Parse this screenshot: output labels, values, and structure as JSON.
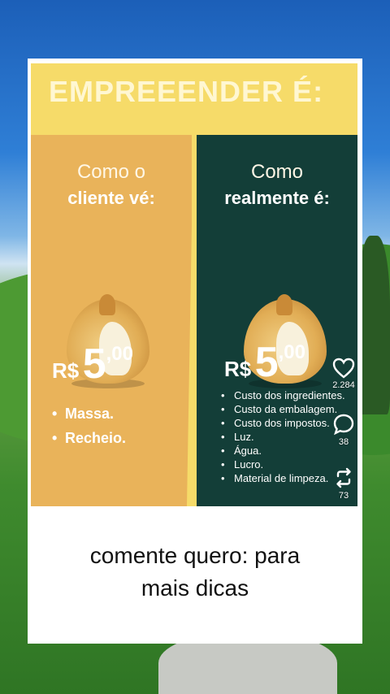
{
  "poster": {
    "title": "EMPREEENDER   É:",
    "left": {
      "line1": "Como o",
      "line2": "cliente vé:",
      "price_currency": "R$",
      "price_main": "5",
      "price_cents": ",00",
      "items": [
        "Massa.",
        "Recheio."
      ]
    },
    "right": {
      "line1": "Como",
      "line2": "realmente é:",
      "price_currency": "R$",
      "price_main": "5",
      "price_cents": ",00",
      "items": [
        "Custo dos ingredientes.",
        "Custo da embalagem.",
        "Custo dos impostos.",
        "Luz.",
        "Água.",
        "Lucro.",
        "Material de limpeza."
      ]
    }
  },
  "actions": {
    "like_icon": "heart-icon",
    "like_count": "2.284",
    "comment_icon": "comment-icon",
    "comment_count": "38",
    "share_icon": "repost-icon",
    "share_count": "73"
  },
  "caption": {
    "line1": "comente quero: para",
    "line2": "mais dicas"
  },
  "colors": {
    "poster_yellow": "#f6db69",
    "left_orange": "#e9b35a",
    "right_green": "#133e38"
  }
}
